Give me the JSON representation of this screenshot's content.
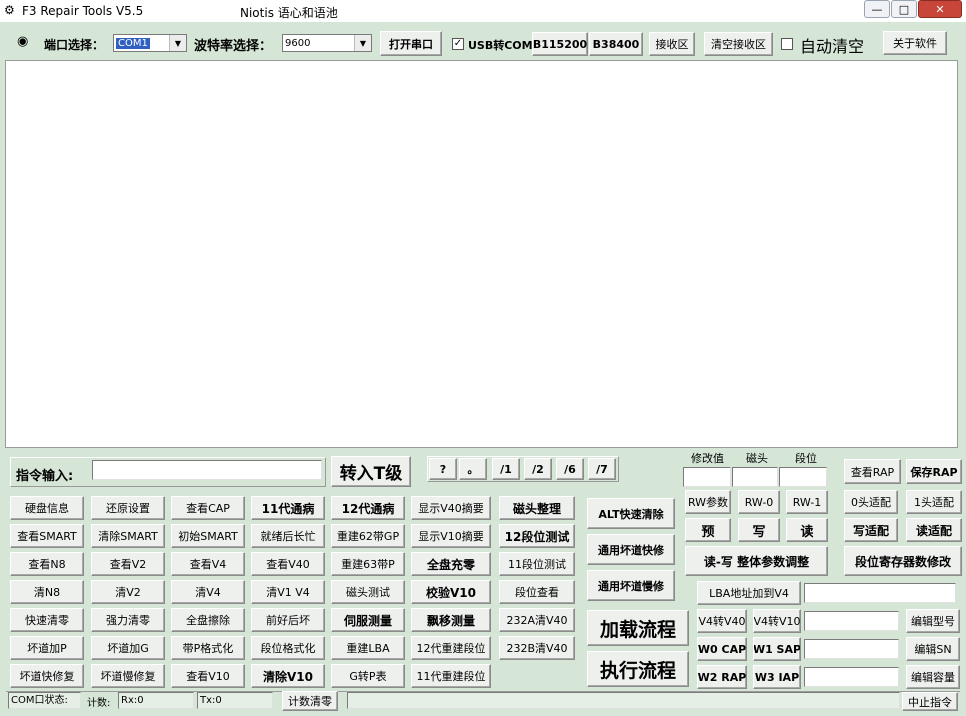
{
  "window": {
    "title": "F3 Repair Tools V5.5",
    "subtitle": "Niotis  语心和语池",
    "min": "—",
    "max": "□",
    "close": "✕"
  },
  "top": {
    "port_label": "端口选择：",
    "port_value": "COM1",
    "baud_label": "波特率选择：",
    "baud_value": "9600",
    "open_port": "打开串口",
    "usb_label": "USB转COM",
    "usb_check": "✓",
    "b115200": "B115200",
    "b38400": "B38400",
    "receive": "接收区",
    "clear_receive": "清空接收区",
    "auto_clear": "自动清空",
    "about": "关于软件"
  },
  "cmd": {
    "label": "指令输入:",
    "goto_t": "转入T级",
    "quick": [
      "?",
      "。",
      "/1",
      "/2",
      "/6",
      "/7"
    ]
  },
  "hdr": {
    "edit_val": "修改值",
    "head": "磁头",
    "segment": "段位"
  },
  "rightTop": {
    "view_rap": "查看RAP",
    "save_rap": "保存RAP"
  },
  "grid": [
    [
      "硬盘信息",
      "还原设置",
      "查看CAP",
      "11代通病",
      "12代通病",
      "显示V40摘要",
      "磁头整理"
    ],
    [
      "查看SMART",
      "清除SMART",
      "初始SMART",
      "就绪后长忙",
      "重建62带GP",
      "显示V10摘要",
      "12段位测试"
    ],
    [
      "查看N8",
      "查看V2",
      "查看V4",
      "查看V40",
      "重建63带P",
      "全盘充零",
      "11段位测试"
    ],
    [
      "清N8",
      "清V2",
      "清V4",
      "清V1 V4",
      "磁头测试",
      "校验V10",
      "段位查看"
    ],
    [
      "快速清零",
      "强力清零",
      "全盘擦除",
      "前好后坏",
      "伺服测量",
      "飘移测量",
      "232A清V40"
    ],
    [
      "坏道加P",
      "坏道加G",
      "带P格式化",
      "段位格式化",
      "重建LBA",
      "12代重建段位",
      "232B清V40"
    ],
    [
      "坏道快修复",
      "坏道慢修复",
      "查看V10",
      "清除V10",
      "G转P表",
      "11代重建段位",
      ""
    ]
  ],
  "mid": {
    "alt_quick": "ALT快速清除",
    "generic_fast": "通用坏道快修",
    "generic_slow": "通用坏道慢修",
    "load_flow": "加载流程",
    "exec_flow": "执行流程"
  },
  "right": {
    "rw_param": "RW参数",
    "rw0": "RW-0",
    "rw1": "RW-1",
    "adapt0": "0头适配",
    "adapt1": "1头适配",
    "pre": "预",
    "write": "写",
    "read": "读",
    "write_adapt": "写适配",
    "read_adapt": "读适配",
    "rw_title": "读-写  整体参数调整",
    "seg_reg": "段位寄存器数修改",
    "lba_add": "LBA地址加到V4",
    "v4_v40": "V4转V40",
    "v4_v10": "V4转V10",
    "edit_model": "编辑型号",
    "w0_cap": "W0 CAP",
    "w1_sap": "W1 SAP",
    "edit_sn": "编辑SN",
    "w2_rap": "W2 RAP",
    "w3_iap": "W3 IAP",
    "edit_capacity": "编辑容量"
  },
  "status": {
    "com_state": "COM口状态:",
    "count": "计数:",
    "rx": "Rx:0",
    "tx": "Tx:0",
    "count_clear": "计数清零",
    "stop": "中止指令"
  }
}
